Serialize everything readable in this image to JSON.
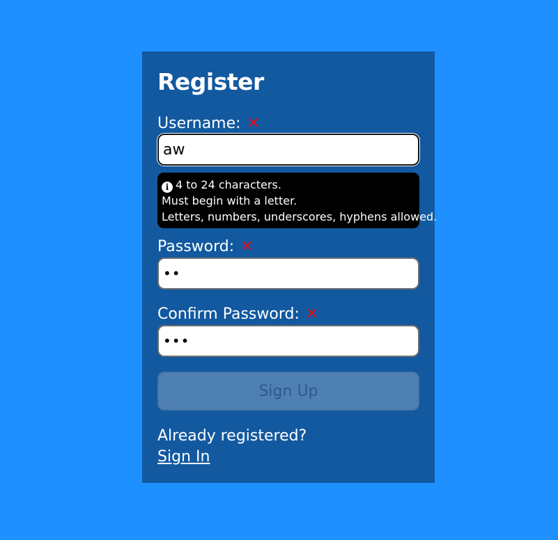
{
  "form": {
    "title": "Register",
    "username": {
      "label": "Username:",
      "value": "aw",
      "invalid_icon": "x-icon"
    },
    "note": {
      "icon": "info-icon",
      "line1": "4 to 24 characters.",
      "line2": "Must begin with a letter.",
      "line3": "Letters, numbers, underscores, hyphens allowed."
    },
    "password": {
      "label": "Password:",
      "masked_value": "••",
      "invalid_icon": "x-icon"
    },
    "confirm": {
      "label": "Confirm Password:",
      "masked_value": "•••",
      "invalid_icon": "x-icon"
    },
    "submit_label": "Sign Up",
    "submit_disabled": true,
    "already_text": "Already registered?",
    "signin_link": "Sign In"
  },
  "colors": {
    "background": "#1e90ff",
    "card": "#1259a0",
    "invalid": "#e0101e",
    "note_bg": "#000000",
    "button_disabled": "#5283b5"
  }
}
